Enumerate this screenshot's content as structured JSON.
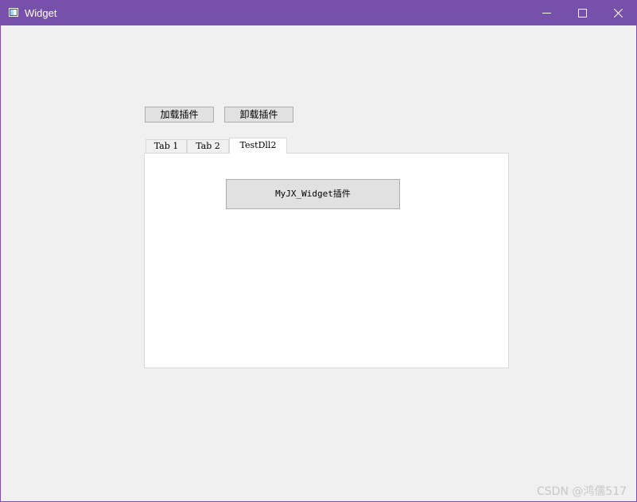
{
  "window": {
    "title": "Widget",
    "colors": {
      "titlebar": "#7650aa",
      "client": "#f0f0f0",
      "button_face": "#e1e1e1",
      "button_border": "#adadad"
    },
    "controls": {
      "minimize_icon": "minimize-icon",
      "maximize_icon": "maximize-icon",
      "close_icon": "close-icon"
    }
  },
  "buttons": {
    "load_plugin": "加载插件",
    "unload_plugin": "卸载插件"
  },
  "tabs": [
    {
      "label": "Tab 1",
      "selected": false
    },
    {
      "label": "Tab 2",
      "selected": false
    },
    {
      "label": "TestDll2",
      "selected": true
    }
  ],
  "tab_content": {
    "plugin_button": "MyJX_Widget插件"
  },
  "watermark": "CSDN @鸿儒517"
}
